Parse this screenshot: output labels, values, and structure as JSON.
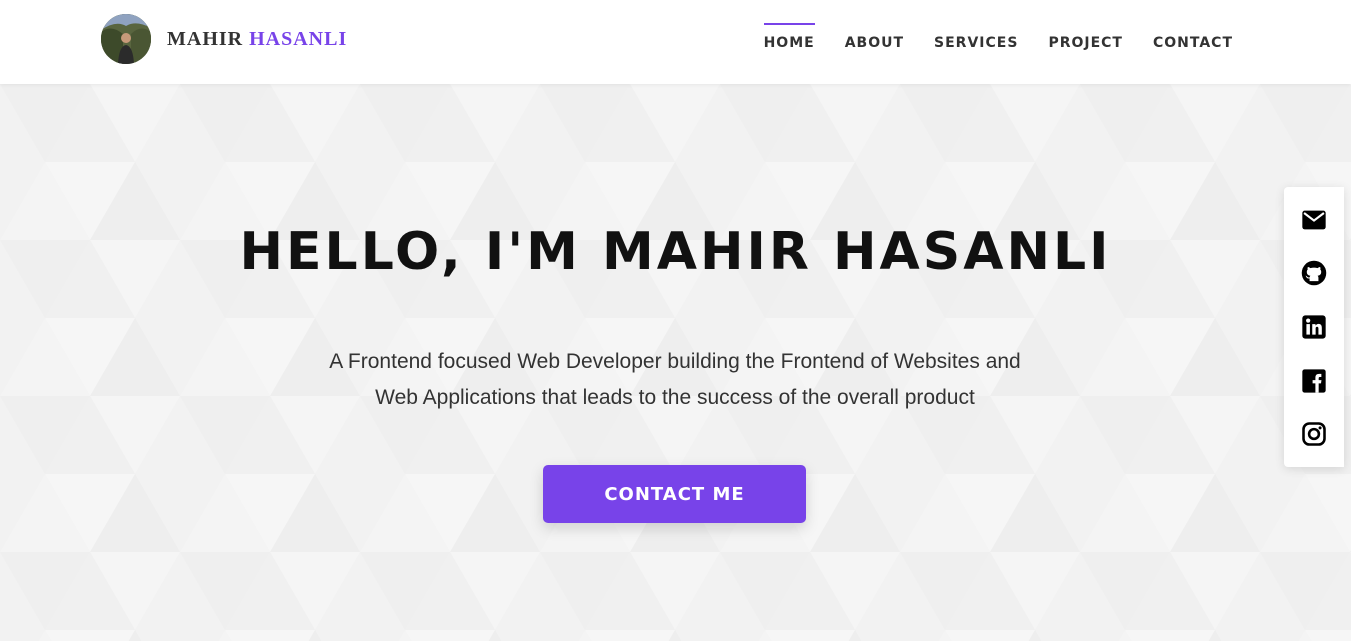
{
  "header": {
    "brand": {
      "first": "MAHIR",
      "last": "HASANLI"
    },
    "nav": [
      {
        "label": "HOME",
        "active": true
      },
      {
        "label": "ABOUT",
        "active": false
      },
      {
        "label": "SERVICES",
        "active": false
      },
      {
        "label": "PROJECT",
        "active": false
      },
      {
        "label": "CONTACT",
        "active": false
      }
    ]
  },
  "hero": {
    "title": "HELLO, I'M MAHIR HASANLI",
    "subtitle": "A Frontend focused Web Developer building the Frontend of Websites and Web Applications that leads to the success of the overall product",
    "cta_label": "CONTACT ME"
  },
  "social": [
    {
      "icon": "mail-icon"
    },
    {
      "icon": "github-icon"
    },
    {
      "icon": "linkedin-icon"
    },
    {
      "icon": "facebook-icon"
    },
    {
      "icon": "instagram-icon"
    }
  ],
  "colors": {
    "accent": "#7843e9",
    "text": "#111111",
    "background": "#f2f2f2"
  }
}
